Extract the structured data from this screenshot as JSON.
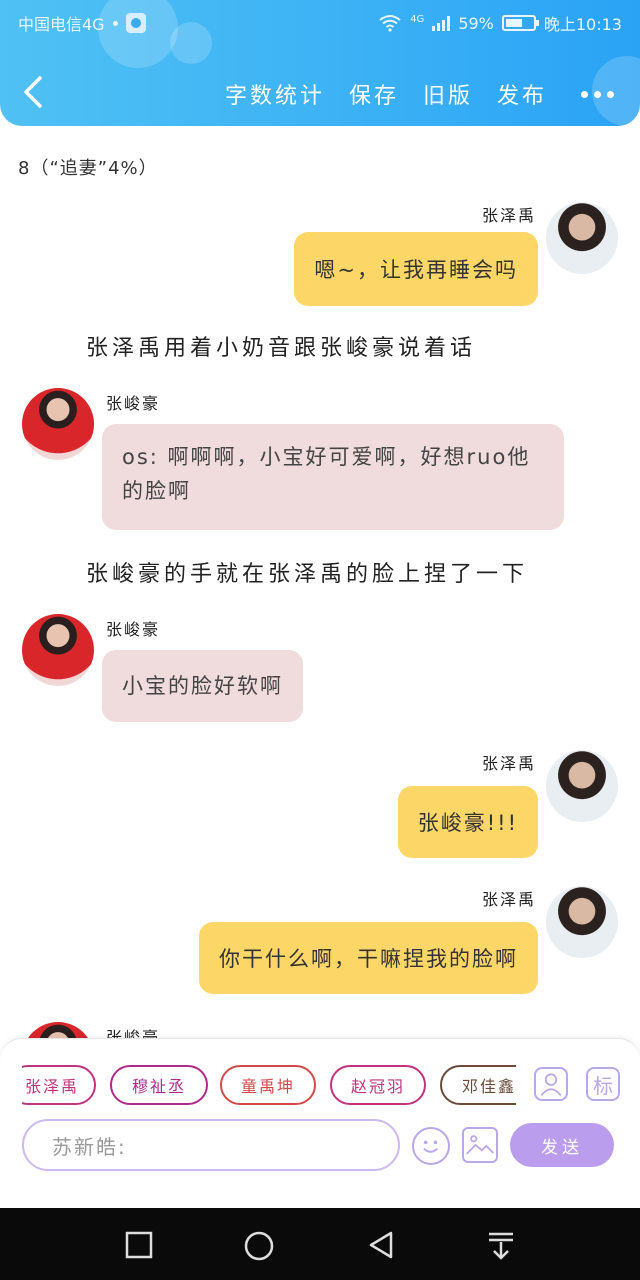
{
  "statusbar": {
    "carrier": "中国电信4G",
    "battery": "59%",
    "time": "晚上10:13",
    "network": "4G"
  },
  "header": {
    "actions": [
      "字数统计",
      "保存",
      "旧版",
      "发布"
    ]
  },
  "word_count": "8（“追妻”4%）",
  "messages": [
    {
      "side": "right",
      "name": "张泽禹",
      "text": "嗯~，让我再睡会吗"
    },
    {
      "type": "narration",
      "text": "张泽禹用着小奶音跟张峻豪说着话"
    },
    {
      "side": "left",
      "name": "张峻豪",
      "text": "os: 啊啊啊，小宝好可爱啊，好想ruo他的脸啊"
    },
    {
      "type": "narration",
      "text": "张峻豪的手就在张泽禹的脸上捏了一下"
    },
    {
      "side": "left",
      "name": "张峻豪",
      "text": "小宝的脸好软啊"
    },
    {
      "side": "right",
      "name": "张泽禹",
      "text": "张峻豪!!!"
    },
    {
      "side": "right",
      "name": "张泽禹",
      "text": "你干什么啊，干嘛捏我的脸啊"
    },
    {
      "side": "left",
      "name": "张峻豪",
      "text": ""
    }
  ],
  "composer": {
    "characters": [
      {
        "name": "张泽禹",
        "color": "#c0337e"
      },
      {
        "name": "穆祉丞",
        "color": "#b02a8a"
      },
      {
        "name": "童禹坤",
        "color": "#d24a4a"
      },
      {
        "name": "赵冠羽",
        "color": "#c4327d"
      },
      {
        "name": "邓佳鑫",
        "color": "#6b4a3a"
      }
    ],
    "side_button": "标",
    "placeholder": "苏新皓:",
    "send_label": "发送",
    "accent": "#bb9ded"
  }
}
